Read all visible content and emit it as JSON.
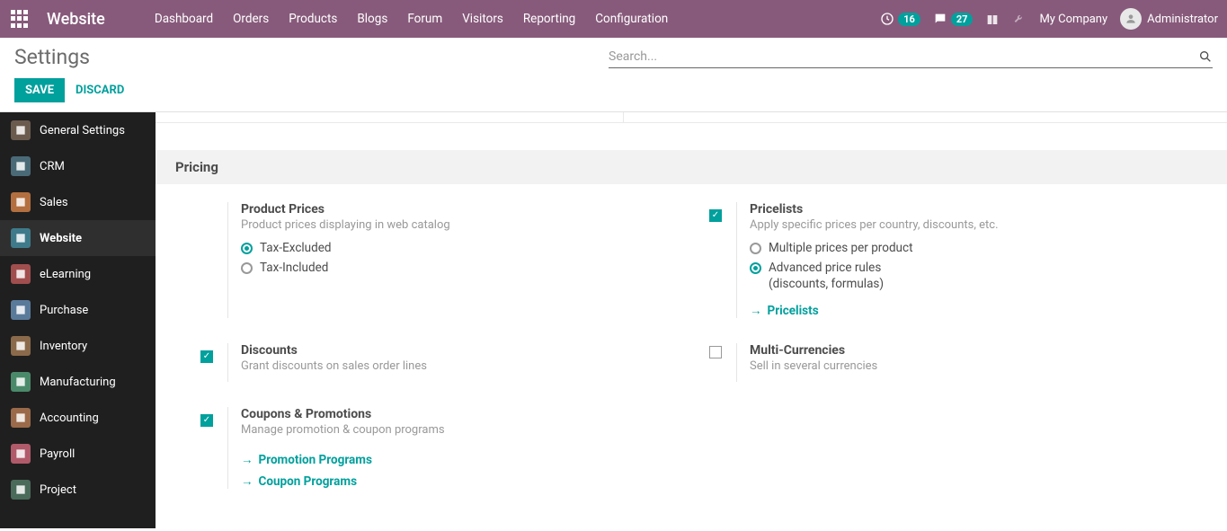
{
  "topnav": {
    "brand": "Website",
    "menu": [
      "Dashboard",
      "Orders",
      "Products",
      "Blogs",
      "Forum",
      "Visitors",
      "Reporting",
      "Configuration"
    ],
    "badge1": "16",
    "badge2": "27",
    "company": "My Company",
    "user": "Administrator"
  },
  "control": {
    "title": "Settings",
    "search_placeholder": "Search...",
    "save": "SAVE",
    "discard": "DISCARD"
  },
  "sidebar": {
    "items": [
      {
        "label": "General Settings",
        "bg": "#6b5b4f"
      },
      {
        "label": "CRM",
        "bg": "#4a6a77"
      },
      {
        "label": "Sales",
        "bg": "#b36f3f"
      },
      {
        "label": "Website",
        "bg": "#3f7a8a"
      },
      {
        "label": "eLearning",
        "bg": "#a14e4e"
      },
      {
        "label": "Purchase",
        "bg": "#5a7a9a"
      },
      {
        "label": "Inventory",
        "bg": "#8a6a4a"
      },
      {
        "label": "Manufacturing",
        "bg": "#4a8a6a"
      },
      {
        "label": "Accounting",
        "bg": "#9a6a4a"
      },
      {
        "label": "Payroll",
        "bg": "#b05a6a"
      },
      {
        "label": "Project",
        "bg": "#4a6a5a"
      }
    ],
    "active_index": 3
  },
  "section": {
    "title": "Pricing",
    "product_prices": {
      "title": "Product Prices",
      "desc": "Product prices displaying in web catalog",
      "opt1": "Tax-Excluded",
      "opt2": "Tax-Included"
    },
    "pricelists": {
      "title": "Pricelists",
      "desc": "Apply specific prices per country, discounts, etc.",
      "opt1": "Multiple prices per product",
      "opt2": "Advanced price rules",
      "opt2_sub": "(discounts, formulas)",
      "link": "Pricelists"
    },
    "discounts": {
      "title": "Discounts",
      "desc": "Grant discounts on sales order lines"
    },
    "multicur": {
      "title": "Multi-Currencies",
      "desc": "Sell in several currencies"
    },
    "coupons": {
      "title": "Coupons & Promotions",
      "desc": "Manage promotion & coupon programs",
      "link1": "Promotion Programs",
      "link2": "Coupon Programs"
    }
  }
}
